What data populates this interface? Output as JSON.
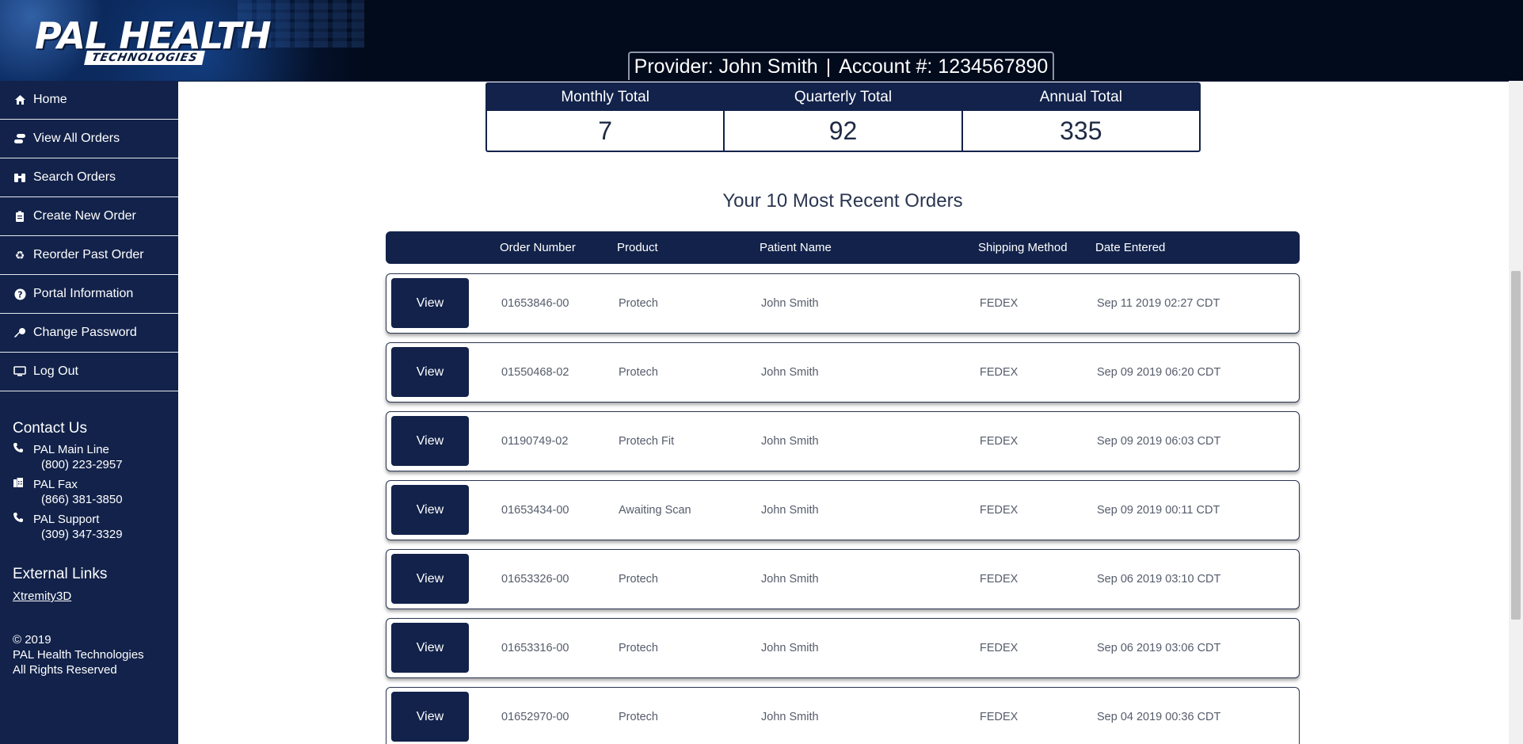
{
  "header": {
    "logo_main": "PAL HEALTH",
    "logo_sub": "TECHNOLOGIES",
    "provider_label": "Provider:",
    "provider_name": "John Smith",
    "separator": "|",
    "account_label": "Account #:",
    "account_number": "1234567890"
  },
  "sidebar": {
    "items": [
      {
        "label": "Home",
        "icon": "home-icon"
      },
      {
        "label": "View All Orders",
        "icon": "orders-icon"
      },
      {
        "label": "Search Orders",
        "icon": "binoculars-icon"
      },
      {
        "label": "Create New Order",
        "icon": "clipboard-icon"
      },
      {
        "label": "Reorder Past Order",
        "icon": "recycle-icon"
      },
      {
        "label": "Portal Information",
        "icon": "question-circle-icon"
      },
      {
        "label": "Change Password",
        "icon": "key-icon"
      },
      {
        "label": "Log Out",
        "icon": "monitor-icon"
      }
    ],
    "contact_title": "Contact Us",
    "contacts": [
      {
        "label": "PAL Main Line",
        "number": "(800) 223-2957",
        "icon": "phone-icon"
      },
      {
        "label": "PAL Fax",
        "number": "(866) 381-3850",
        "icon": "fax-icon"
      },
      {
        "label": "PAL Support",
        "number": "(309) 347-3329",
        "icon": "phone-icon"
      }
    ],
    "external_title": "External Links",
    "external_link": "Xtremity3D",
    "footer": {
      "line1": "© 2019",
      "line2": "PAL Health Technologies",
      "line3": "All Rights Reserved"
    }
  },
  "totals": {
    "monthly_label": "Monthly Total",
    "monthly_value": "7",
    "quarterly_label": "Quarterly Total",
    "quarterly_value": "92",
    "annual_label": "Annual Total",
    "annual_value": "335"
  },
  "recent": {
    "title": "Your 10 Most Recent Orders",
    "columns": [
      "Order Number",
      "Product",
      "Patient Name",
      "Shipping Method",
      "Date Entered"
    ],
    "view_label": "View",
    "rows": [
      {
        "order": "01653846-00",
        "product": "Protech",
        "patient": "John Smith",
        "shipping": "FEDEX",
        "date": "Sep 11 2019 02:27 CDT"
      },
      {
        "order": "01550468-02",
        "product": "Protech",
        "patient": "John Smith",
        "shipping": "FEDEX",
        "date": "Sep 09 2019 06:20 CDT"
      },
      {
        "order": "01190749-02",
        "product": "Protech Fit",
        "patient": "John Smith",
        "shipping": "FEDEX",
        "date": "Sep 09 2019 06:03 CDT"
      },
      {
        "order": "01653434-00",
        "product": "Awaiting Scan",
        "patient": "John Smith",
        "shipping": "FEDEX",
        "date": "Sep 09 2019 00:11 CDT"
      },
      {
        "order": "01653326-00",
        "product": "Protech",
        "patient": "John Smith",
        "shipping": "FEDEX",
        "date": "Sep 06 2019 03:10 CDT"
      },
      {
        "order": "01653316-00",
        "product": "Protech",
        "patient": "John Smith",
        "shipping": "FEDEX",
        "date": "Sep 06 2019 03:06 CDT"
      },
      {
        "order": "01652970-00",
        "product": "Protech",
        "patient": "John Smith",
        "shipping": "FEDEX",
        "date": "Sep 04 2019 00:36 CDT"
      }
    ]
  },
  "colors": {
    "navy": "#12224a",
    "header_bg": "#020b1c"
  }
}
